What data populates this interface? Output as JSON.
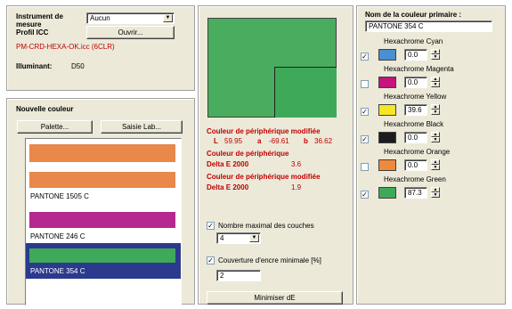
{
  "instrument": {
    "label": "Instrument de mesure",
    "value": "Aucun",
    "profile_label": "Profil ICC",
    "open_button": "Ouvrir...",
    "profile_file": "PM-CRD-HEXA-OK.icc (6CLR)",
    "illuminant_label": "Illuminant:",
    "illuminant_value": "D50"
  },
  "new_color": {
    "title": "Nouvelle couleur",
    "palette_button": "Palette...",
    "lab_button": "Saisie Lab...",
    "items": [
      {
        "name": "",
        "color": "#e8884a",
        "selected": false
      },
      {
        "name": "PANTONE 1505 C",
        "color": "#e8884a",
        "selected": false
      },
      {
        "name": "PANTONE 246 C",
        "color": "#b5288f",
        "selected": false
      },
      {
        "name": "PANTONE 354 C",
        "color": "#3fa95a",
        "selected": true
      }
    ]
  },
  "preview": {
    "main_color": "#4aac5e",
    "inset_color": "#3fa95a"
  },
  "device": {
    "modified_title": "Couleur de périphérique modifiée",
    "lab_L": "L",
    "lab_L_val": "59.95",
    "lab_a": "a",
    "lab_a_val": "-69.61",
    "lab_b": "b",
    "lab_b_val": "36.62",
    "device_title": "Couleur de périphérique",
    "delta1_label": "Delta E 2000",
    "delta1_value": "3.6",
    "modified_title2": "Couleur de périphérique modifiée",
    "delta2_label": "Delta E 2000",
    "delta2_value": "1.9"
  },
  "options": {
    "max_layers_label": "Nombre maximal des couches",
    "max_layers_checked": true,
    "max_layers_value": "4",
    "min_coverage_label": "Couverture d'encre minimale [%]",
    "min_coverage_checked": true,
    "min_coverage_value": "2",
    "minimize_button": "Minimiser dE"
  },
  "primary": {
    "title": "Nom de la couleur primaire :",
    "name_value": "PANTONE 354 C",
    "inks": [
      {
        "label": "Hexachrome Cyan",
        "checked": true,
        "color": "#4a90d0",
        "value": "0.0"
      },
      {
        "label": "Hexachrome Magenta",
        "checked": false,
        "color": "#c8127e",
        "value": "0.0"
      },
      {
        "label": "Hexachrome Yellow",
        "checked": true,
        "color": "#f5e626",
        "value": "39.6"
      },
      {
        "label": "Hexachrome Black",
        "checked": true,
        "color": "#1c1c1c",
        "value": "0.0"
      },
      {
        "label": "Hexachrome Orange",
        "checked": false,
        "color": "#ef8a3c",
        "value": "0.0"
      },
      {
        "label": "Hexachrome Green",
        "checked": true,
        "color": "#3fa95a",
        "value": "87.3"
      }
    ]
  },
  "colors": {
    "panel_bg": "#ece9d8",
    "selection": "#2b3a8c",
    "accent_red": "#c00000"
  }
}
